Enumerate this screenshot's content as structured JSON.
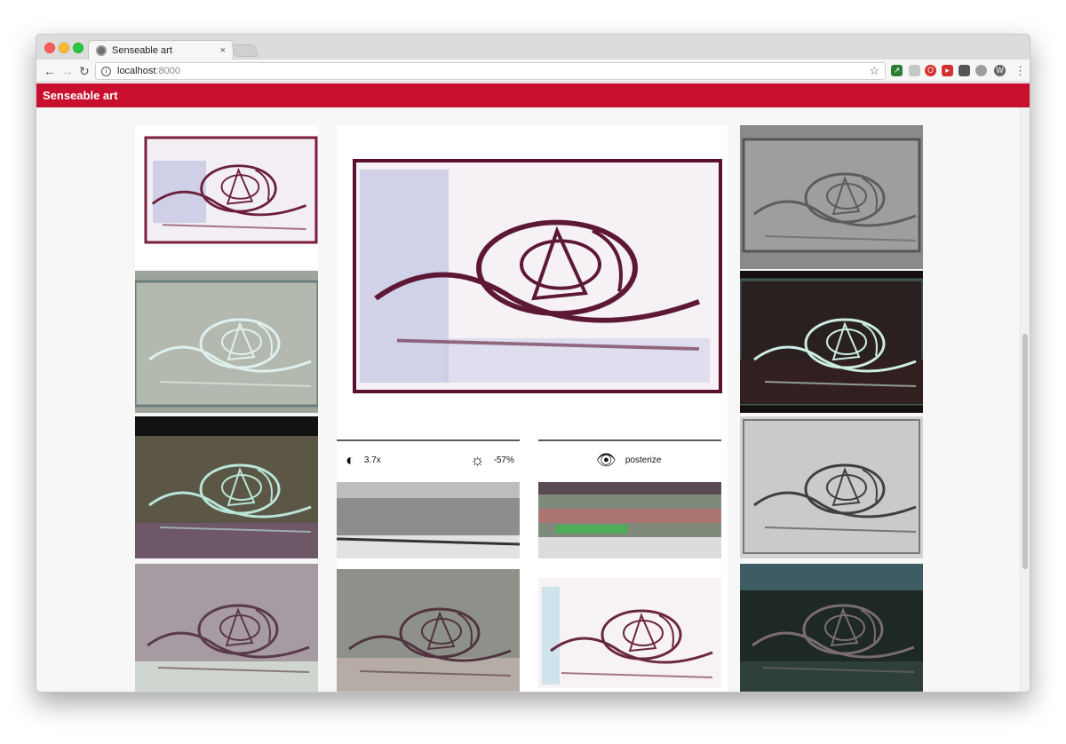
{
  "browser": {
    "tab_title": "Senseable art",
    "tab_close": "×",
    "url_host": "localhost",
    "url_port": ":8000"
  },
  "app": {
    "title": "Senseable art",
    "accent_color": "#c8102e"
  },
  "controls": {
    "contrast_value": "3.7x",
    "brightness_value": "-57%",
    "filter_value": "posterize"
  },
  "icons": {
    "contrast": "contrast-icon",
    "brightness": "brightness-icon",
    "view": "eye-icon"
  }
}
